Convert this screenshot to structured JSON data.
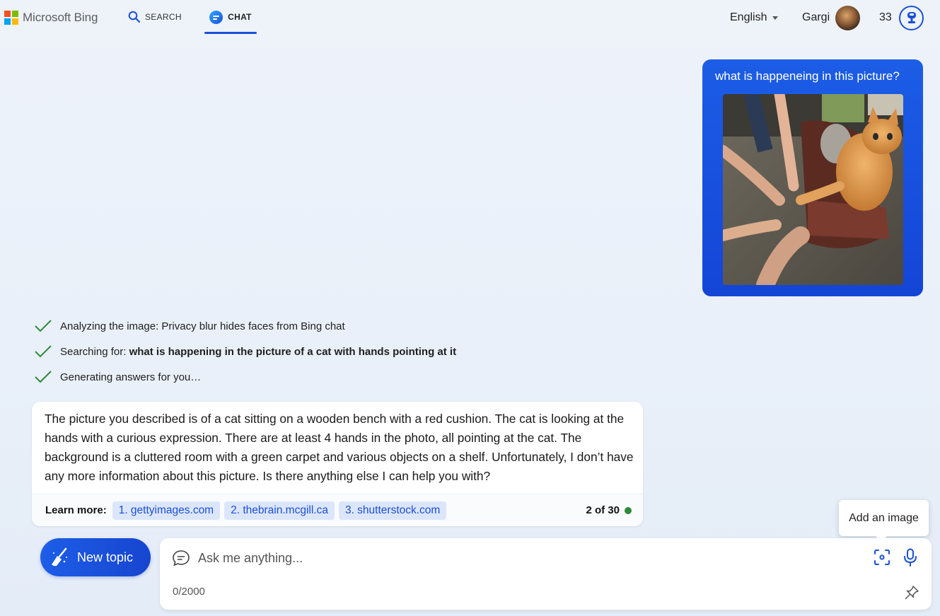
{
  "header": {
    "logo_text": "Microsoft Bing",
    "tabs": [
      {
        "label": "SEARCH",
        "active": false
      },
      {
        "label": "CHAT",
        "active": true
      }
    ],
    "language": "English",
    "user_name": "Gargi",
    "reward_points": "33"
  },
  "colors": {
    "accent": "#1a4fd8",
    "user_bubble": "#1c5de6",
    "success": "#2f8a3a",
    "ms_red": "#f25022",
    "ms_green": "#7fba00",
    "ms_blue": "#00a4ef",
    "ms_yellow": "#ffb900"
  },
  "conversation": {
    "user_message": "what is happeneing in this picture?",
    "progress_steps": [
      {
        "prefix": "Analyzing the image: Privacy blur hides faces from Bing chat",
        "bold": ""
      },
      {
        "prefix": "Searching for: ",
        "bold": "what is happening in the picture of a cat with hands pointing at it"
      },
      {
        "prefix": "Generating answers for you…",
        "bold": ""
      }
    ],
    "bot_reply": "The picture you described is of a cat sitting on a wooden bench with a red cushion. The cat is looking at the hands with a curious expression. There are at least 4 hands in the photo, all pointing at the cat. The background is a cluttered room with a green carpet and various objects on a shelf. Unfortunately, I don’t have any more information about this picture. Is there anything else I can help you with?",
    "learn_more_label": "Learn more:",
    "sources": [
      "1. gettyimages.com",
      "2. thebrain.mcgill.ca",
      "3. shutterstock.com"
    ],
    "turn_count": "2 of 30"
  },
  "composer": {
    "new_topic_label": "New topic",
    "placeholder": "Ask me anything...",
    "char_count": "0/2000",
    "tooltip": "Add an image"
  },
  "icons": {
    "search": "search-icon",
    "chat": "chat-bubble-icon",
    "reward": "trophy-icon",
    "check": "checkmark-icon",
    "broom": "broom-icon",
    "image": "image-capture-icon",
    "mic": "microphone-icon",
    "pin": "pin-icon"
  }
}
